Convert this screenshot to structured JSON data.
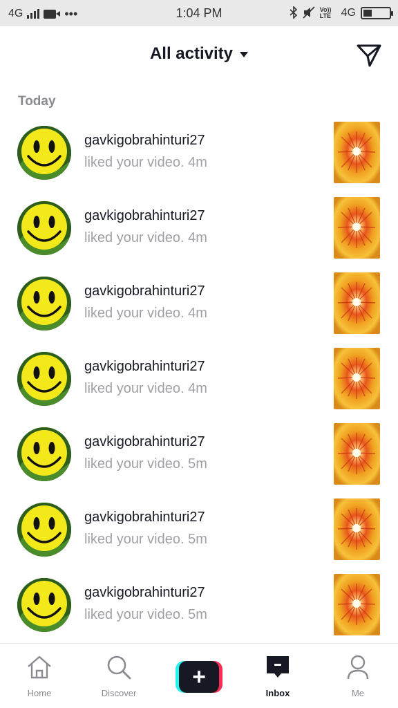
{
  "status_bar": {
    "network": "4G",
    "time": "1:04 PM",
    "volte": "Vo)) LTE",
    "network_right": "4G",
    "battery_level": 0.25
  },
  "header": {
    "title": "All activity",
    "dropdown_icon": "caret-down-icon",
    "action_icon": "direct-message-icon"
  },
  "section": {
    "label": "Today"
  },
  "notifications": [
    {
      "username": "gavkigobrahinturi27",
      "action": "liked your video.",
      "time": "4m"
    },
    {
      "username": "gavkigobrahinturi27",
      "action": "liked your video.",
      "time": "4m"
    },
    {
      "username": "gavkigobrahinturi27",
      "action": "liked your video.",
      "time": "4m"
    },
    {
      "username": "gavkigobrahinturi27",
      "action": "liked your video.",
      "time": "4m"
    },
    {
      "username": "gavkigobrahinturi27",
      "action": "liked your video.",
      "time": "5m"
    },
    {
      "username": "gavkigobrahinturi27",
      "action": "liked your video.",
      "time": "5m"
    },
    {
      "username": "gavkigobrahinturi27",
      "action": "liked your video.",
      "time": "5m"
    }
  ],
  "bottom_nav": {
    "home": "Home",
    "discover": "Discover",
    "create": "+",
    "inbox": "Inbox",
    "me": "Me",
    "active": "inbox"
  },
  "colors": {
    "text_primary": "#161823",
    "text_secondary": "#a0a1a6",
    "section_label": "#8a8b91",
    "create_cyan": "#25f4ee",
    "create_pink": "#fe2c55"
  }
}
